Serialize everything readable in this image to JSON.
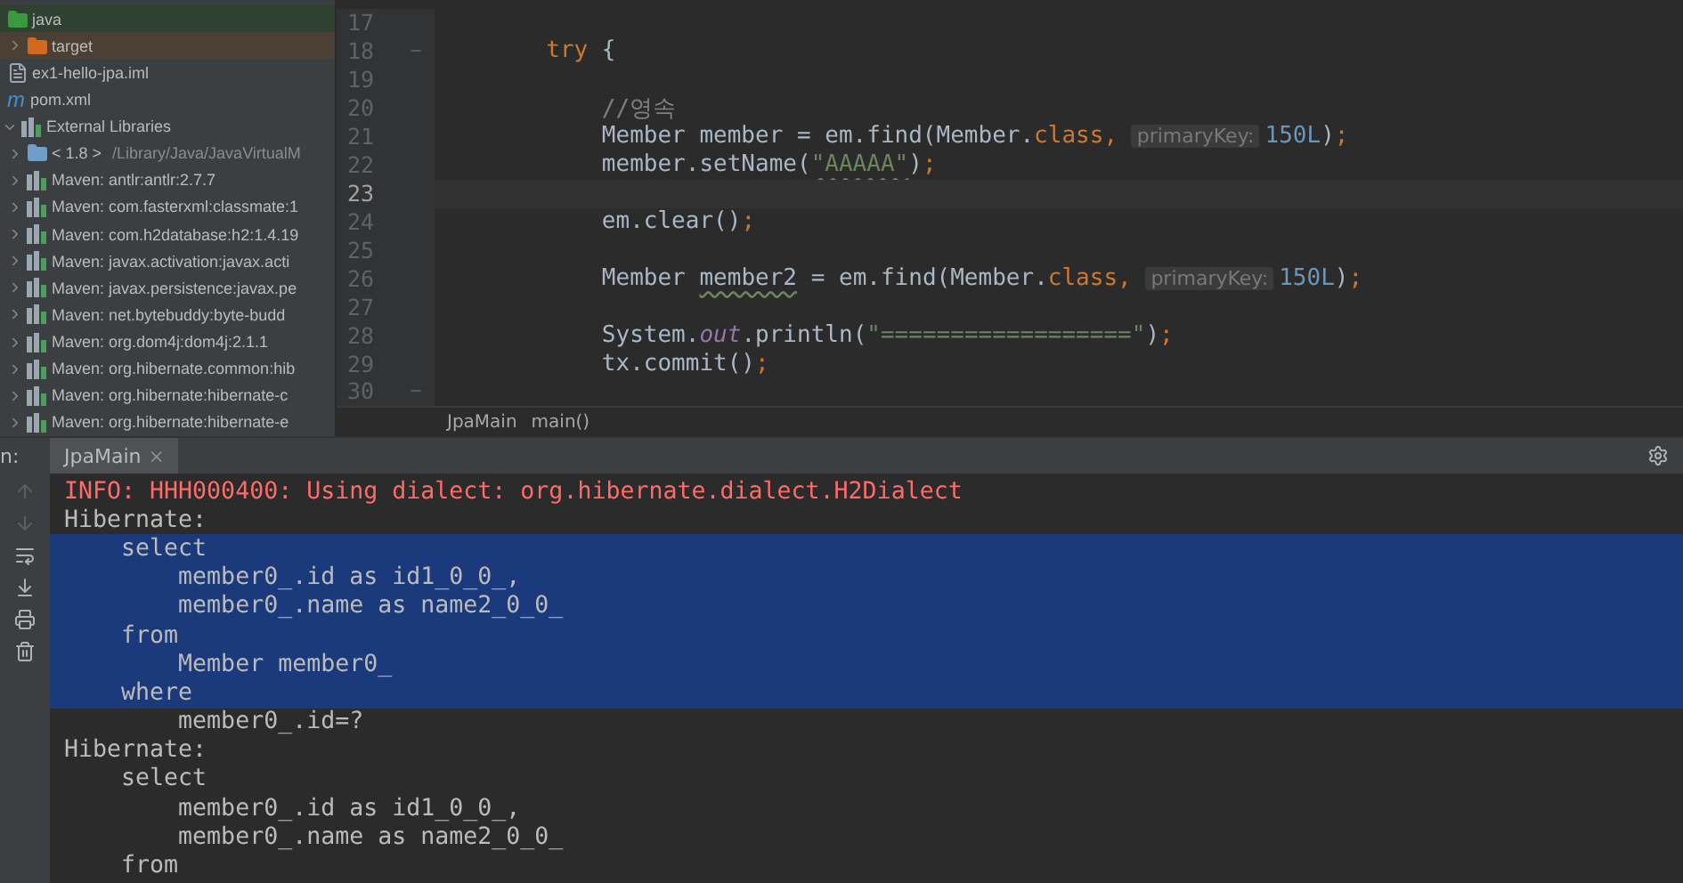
{
  "project_tree": [
    {
      "label": "java",
      "kind": "source-folder"
    },
    {
      "label": "target",
      "kind": "excluded-folder",
      "expanded": false
    },
    {
      "label": "ex1-hello-jpa.iml",
      "kind": "module-file"
    },
    {
      "label": "pom.xml",
      "kind": "maven-file",
      "icon_glyph": "m"
    },
    {
      "label": "External Libraries",
      "kind": "libraries",
      "expanded": true,
      "children": [
        {
          "label": "< 1.8 >",
          "detail": "/Library/Java/JavaVirtualM",
          "kind": "jdk",
          "expanded": false
        },
        {
          "label": "Maven: antlr:antlr:2.7.7",
          "kind": "library",
          "expanded": false
        },
        {
          "label": "Maven: com.fasterxml:classmate:1",
          "kind": "library",
          "expanded": false
        },
        {
          "label": "Maven: com.h2database:h2:1.4.19",
          "kind": "library",
          "expanded": false
        },
        {
          "label": "Maven: javax.activation:javax.acti",
          "kind": "library",
          "expanded": false
        },
        {
          "label": "Maven: javax.persistence:javax.pe",
          "kind": "library",
          "expanded": false
        },
        {
          "label": "Maven: net.bytebuddy:byte-budd",
          "kind": "library",
          "expanded": false
        },
        {
          "label": "Maven: org.dom4j:dom4j:2.1.1",
          "kind": "library",
          "expanded": false
        },
        {
          "label": "Maven: org.hibernate.common:hib",
          "kind": "library",
          "expanded": false
        },
        {
          "label": "Maven: org.hibernate:hibernate-c",
          "kind": "library",
          "expanded": false
        },
        {
          "label": "Maven: org.hibernate:hibernate-e",
          "kind": "library",
          "expanded": false
        }
      ]
    }
  ],
  "editor": {
    "lines": [
      {
        "number": "17",
        "current": false
      },
      {
        "number": "18",
        "current": false,
        "fold": true,
        "tokens": [
          {
            "kind": "keyword",
            "text": "        try "
          },
          {
            "kind": "plain",
            "text": "{"
          }
        ]
      },
      {
        "number": "19",
        "current": false
      },
      {
        "number": "20",
        "current": false,
        "tokens": [
          {
            "kind": "comment",
            "text": "            //영속"
          }
        ]
      },
      {
        "number": "21",
        "current": false,
        "tokens": [
          {
            "kind": "plain",
            "text": "            Member member = em.find(Member."
          },
          {
            "kind": "keyword",
            "text": "class"
          },
          {
            "kind": "punct",
            "text": ", "
          },
          {
            "kind": "hint",
            "text": "primaryKey:"
          },
          {
            "kind": "number",
            "text": "150L"
          },
          {
            "kind": "plain",
            "text": ")"
          },
          {
            "kind": "punct",
            "text": ";"
          }
        ]
      },
      {
        "number": "22",
        "current": false,
        "tokens": [
          {
            "kind": "plain",
            "text": "            member.setName("
          },
          {
            "kind": "string-warning",
            "text": "\"AAAAA\""
          },
          {
            "kind": "plain",
            "text": ")"
          },
          {
            "kind": "punct",
            "text": ";"
          }
        ]
      },
      {
        "number": "23",
        "current": true
      },
      {
        "number": "24",
        "current": false,
        "tokens": [
          {
            "kind": "plain",
            "text": "            em.clear()"
          },
          {
            "kind": "punct",
            "text": ";"
          }
        ]
      },
      {
        "number": "25",
        "current": false
      },
      {
        "number": "26",
        "current": false,
        "tokens": [
          {
            "kind": "plain",
            "text": "            Member "
          },
          {
            "kind": "unused",
            "text": "member2"
          },
          {
            "kind": "plain",
            "text": " = em.find(Member."
          },
          {
            "kind": "keyword",
            "text": "class"
          },
          {
            "kind": "punct",
            "text": ", "
          },
          {
            "kind": "hint",
            "text": "primaryKey:"
          },
          {
            "kind": "number",
            "text": "150L"
          },
          {
            "kind": "plain",
            "text": ")"
          },
          {
            "kind": "punct",
            "text": ";"
          }
        ]
      },
      {
        "number": "27",
        "current": false
      },
      {
        "number": "28",
        "current": false,
        "tokens": [
          {
            "kind": "plain",
            "text": "            System."
          },
          {
            "kind": "static",
            "text": "out"
          },
          {
            "kind": "plain",
            "text": ".println("
          },
          {
            "kind": "string",
            "text": "\"==================\""
          },
          {
            "kind": "plain",
            "text": ")"
          },
          {
            "kind": "punct",
            "text": ";"
          }
        ]
      },
      {
        "number": "29",
        "current": false,
        "tokens": [
          {
            "kind": "plain",
            "text": "            tx.commit()"
          },
          {
            "kind": "punct",
            "text": ";"
          }
        ]
      },
      {
        "number": "30",
        "current": false,
        "fold": true
      }
    ],
    "breadcrumbs": [
      "JpaMain",
      "main()"
    ]
  },
  "run_panel": {
    "label": "n:",
    "tab": {
      "label": "JpaMain",
      "close": "×"
    },
    "lines": [
      {
        "kind": "error",
        "text": "INFO: HHH000400: Using dialect: org.hibernate.dialect.H2Dialect",
        "selected": false
      },
      {
        "kind": "output",
        "text": "Hibernate:",
        "selected": false
      },
      {
        "kind": "output",
        "text": "    select",
        "selected": true
      },
      {
        "kind": "output",
        "text": "        member0_.id as id1_0_0_,",
        "selected": true
      },
      {
        "kind": "output",
        "text": "        member0_.name as name2_0_0_",
        "selected": true
      },
      {
        "kind": "output",
        "text": "    from",
        "selected": true
      },
      {
        "kind": "output",
        "text": "        Member member0_",
        "selected": true
      },
      {
        "kind": "output",
        "text": "    where",
        "selected": true
      },
      {
        "kind": "output",
        "text": "        member0_.id=?",
        "selected": false
      },
      {
        "kind": "output",
        "text": "Hibernate:",
        "selected": false
      },
      {
        "kind": "output",
        "text": "    select",
        "selected": false
      },
      {
        "kind": "output",
        "text": "        member0_.id as id1_0_0_,",
        "selected": false
      },
      {
        "kind": "output",
        "text": "        member0_.name as name2_0_0_",
        "selected": false
      },
      {
        "kind": "output",
        "text": "    from",
        "selected": false
      }
    ]
  }
}
